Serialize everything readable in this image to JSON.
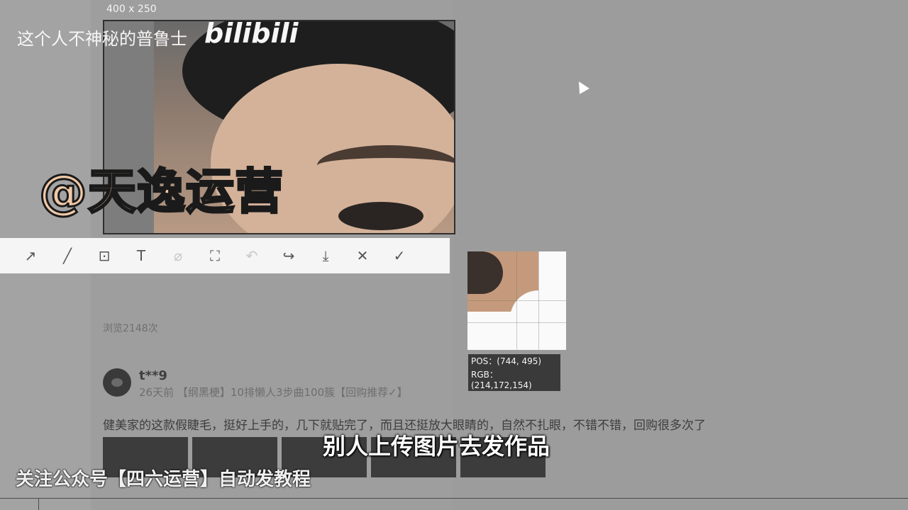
{
  "overlay": {
    "size_label": "400 x 250",
    "channel_name": "这个人不神秘的普鲁士",
    "brand": "bilibili",
    "watermark": "@天逸运营",
    "subtitle": "别人上传图片去发作品",
    "follow_note": "关注公众号【四六运营】自动发教程"
  },
  "toolbar": {
    "tools": [
      {
        "name": "arrow-tool",
        "icon": "arrow-icon",
        "glyph": "↗"
      },
      {
        "name": "line-tool",
        "icon": "line-icon",
        "glyph": "╱"
      },
      {
        "name": "mosaic-tool",
        "icon": "mosaic-icon",
        "glyph": "⊡"
      },
      {
        "name": "text-tool",
        "icon": "text-icon",
        "glyph": "T"
      },
      {
        "name": "eraser-tool",
        "icon": "eraser-icon",
        "glyph": "⌀"
      },
      {
        "name": "ocr-tool",
        "icon": "ocr-icon",
        "glyph": "⛶"
      },
      {
        "name": "undo-tool",
        "icon": "undo-icon",
        "glyph": "↶"
      },
      {
        "name": "share-tool",
        "icon": "share-icon",
        "glyph": "↪"
      },
      {
        "name": "save-tool",
        "icon": "download-icon",
        "glyph": "⤓"
      },
      {
        "name": "cancel-tool",
        "icon": "close-icon",
        "glyph": "✕"
      },
      {
        "name": "confirm-tool",
        "icon": "check-icon",
        "glyph": "✓"
      }
    ]
  },
  "magnifier": {
    "pos": "POS：(744, 495)",
    "rgb": "RGB：(214,172,154)"
  },
  "review": {
    "views": "浏览2148次",
    "username": "t**9",
    "meta": "26天前 【纲黑梗】10排懒人3步曲100簇【回购推荐✓】",
    "text": "健美家的这款假睫毛，挺好上手的，几下就贴完了，而且还挺放大眼睛的，自然不扎眼，不错不错，回购很多次了"
  }
}
